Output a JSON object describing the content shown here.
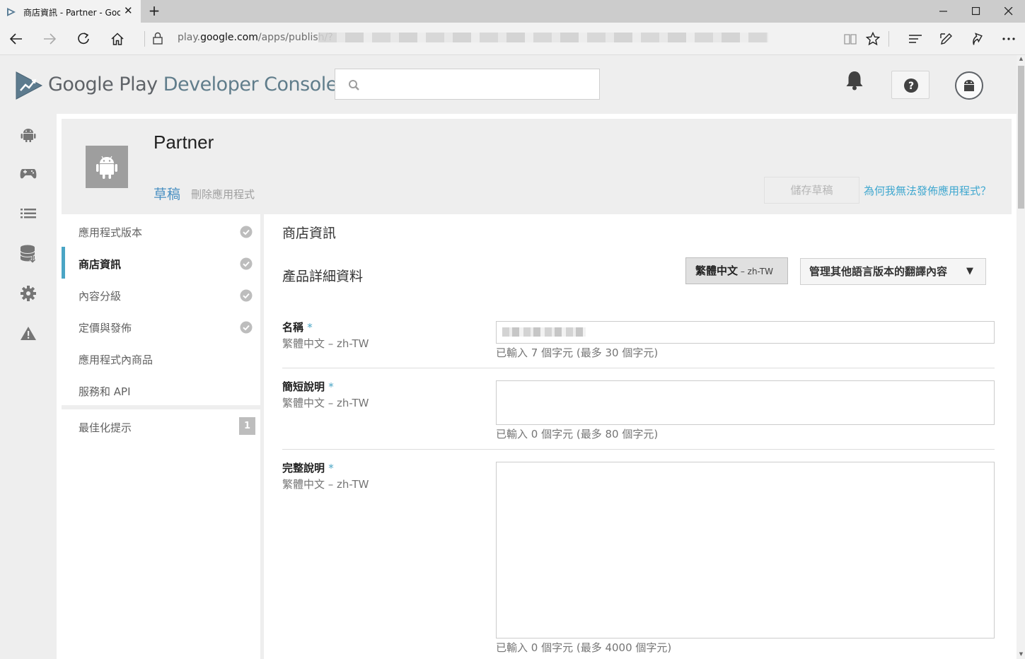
{
  "browser": {
    "tab_title": "商店資訊 - Partner - Google Play Developer Console",
    "new_tab": "+",
    "tab_close": "✕",
    "url_prefix": "play.",
    "url_domain": "google.com",
    "url_path": "/apps/publish/?"
  },
  "header": {
    "logo_google_play": "Google Play",
    "logo_dev_console": " Developer Console",
    "search_placeholder": ""
  },
  "app": {
    "name": "Partner",
    "status": "草稿",
    "delete_link": "刪除應用程式",
    "save_draft": "儲存草稿",
    "why_cant_publish": "為何我無法發佈應用程式？"
  },
  "sidemenu": {
    "items": [
      {
        "label": "應用程式版本",
        "checked": true,
        "active": false
      },
      {
        "label": "商店資訊",
        "checked": true,
        "active": true
      },
      {
        "label": "內容分級",
        "checked": true,
        "active": false
      },
      {
        "label": "定價與發佈",
        "checked": true,
        "active": false
      },
      {
        "label": "應用程式內商品",
        "checked": false,
        "active": false
      },
      {
        "label": "服務和 API",
        "checked": false,
        "active": false
      }
    ],
    "optimization": {
      "label": "最佳化提示",
      "badge": "1"
    }
  },
  "content": {
    "section_title": "商店資訊",
    "subsection_title": "產品詳細資料",
    "language_button": {
      "label": "繁體中文",
      "code": " – zh-TW"
    },
    "manage_translations": "管理其他語言版本的翻譯內容",
    "manage_caret": "▼",
    "fields": [
      {
        "label": "名稱",
        "required": "*",
        "lang": "繁體中文 – zh-TW",
        "count": "已輸入 7 個字元 (最多 30 個字元)"
      },
      {
        "label": "簡短說明",
        "required": "*",
        "lang": "繁體中文 – zh-TW",
        "count": "已輸入 0 個字元 (最多 80 個字元)"
      },
      {
        "label": "完整說明",
        "required": "*",
        "lang": "繁體中文 – zh-TW",
        "count": "已輸入 0 個字元 (最多 4000 個字元)"
      }
    ]
  },
  "colors": {
    "accent": "#4aa5c5",
    "link": "#3ea7cf",
    "chrome_bg": "#f2f2f2",
    "page_bg": "#eeeeee"
  }
}
